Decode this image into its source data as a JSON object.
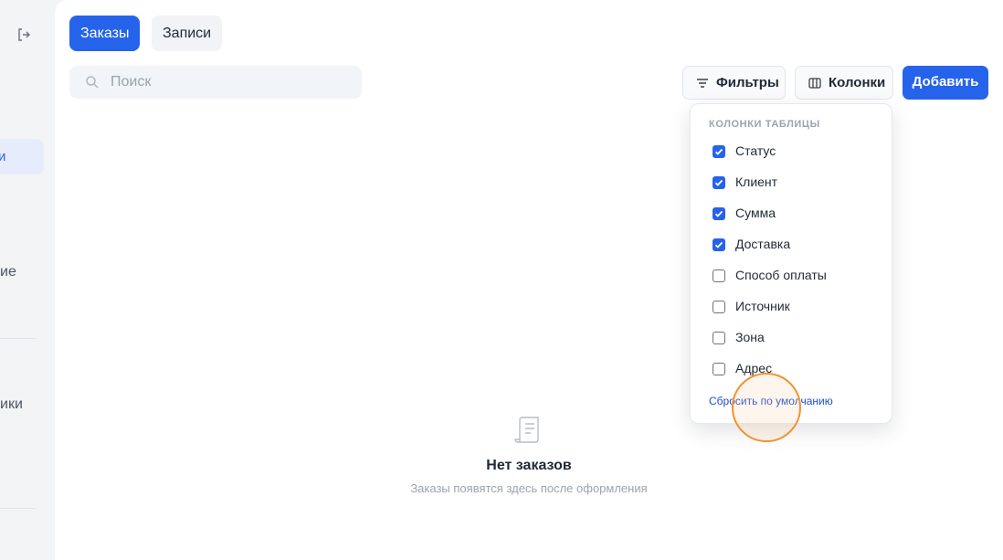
{
  "sidebar": {
    "active_fragment": "и",
    "fragment_1": "ие",
    "fragment_2": "ики"
  },
  "tabs": [
    {
      "label": "Заказы",
      "active": true
    },
    {
      "label": "Записи",
      "active": false
    }
  ],
  "search": {
    "placeholder": "Поиск"
  },
  "toolbar": {
    "filters_label": "Фильтры",
    "columns_label": "Колонки",
    "add_label": "Добавить"
  },
  "columns_menu": {
    "heading": "КОЛОНКИ ТАБЛИЦЫ",
    "options": [
      {
        "label": "Статус",
        "checked": true
      },
      {
        "label": "Клиент",
        "checked": true
      },
      {
        "label": "Сумма",
        "checked": true
      },
      {
        "label": "Доставка",
        "checked": true
      },
      {
        "label": "Способ оплаты",
        "checked": false
      },
      {
        "label": "Источник",
        "checked": false
      },
      {
        "label": "Зона",
        "checked": false
      },
      {
        "label": "Адрес",
        "checked": false
      }
    ],
    "reset_label": "Сбросить по умолчанию"
  },
  "empty_state": {
    "title": "Нет заказов",
    "subtitle": "Заказы появятся здесь после оформления"
  },
  "colors": {
    "accent": "#2563eb",
    "cursor_ring": "#f0922e"
  }
}
